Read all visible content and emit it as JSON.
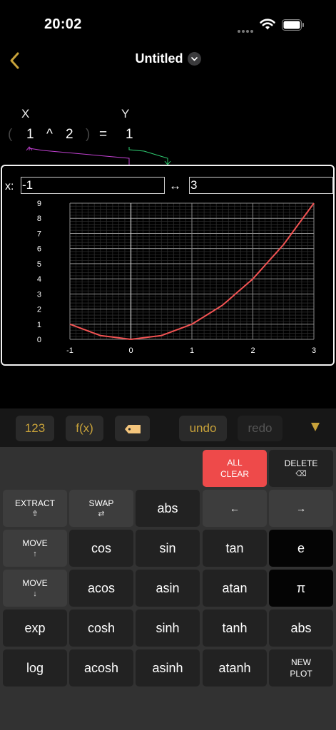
{
  "status": {
    "time": "20:02"
  },
  "nav": {
    "title": "Untitled"
  },
  "expression": {
    "label_x": "X",
    "label_y": "Y",
    "open_paren": "(",
    "base": "1",
    "operator": "^",
    "exponent": "2",
    "close_paren": ")",
    "equals": "=",
    "result": "1"
  },
  "plot": {
    "x_label": "x:",
    "range_min": "-1",
    "range_sep": "↔",
    "range_max": "3"
  },
  "chart_data": {
    "type": "line",
    "xlim": [
      -1,
      3
    ],
    "ylim": [
      0,
      9
    ],
    "x_ticks": [
      "-1",
      "0",
      "1",
      "2",
      "3"
    ],
    "y_ticks": [
      "0",
      "1",
      "2",
      "3",
      "4",
      "5",
      "6",
      "7",
      "8",
      "9"
    ],
    "grid": true,
    "series": [
      {
        "x": [
          -1,
          -0.5,
          0,
          0.5,
          1,
          1.5,
          2,
          2.5,
          3
        ],
        "y": [
          1,
          0.25,
          0,
          0.25,
          1,
          2.25,
          4,
          6.25,
          9
        ],
        "color": "#f25252"
      }
    ]
  },
  "toolbar": {
    "numbers": "123",
    "functions": "f(x)",
    "undo": "undo",
    "redo": "redo",
    "accent": "#c8a23a"
  },
  "keys": {
    "all_clear_1": "ALL",
    "all_clear_2": "CLEAR",
    "delete": "DELETE",
    "delete_icon": "⌫",
    "extract": "EXTRACT",
    "extract_icon": "⇮",
    "swap": "SWAP",
    "swap_icon": "⇄",
    "abs": "abs",
    "left": "←",
    "right": "→",
    "move_up": "MOVE",
    "up_icon": "↑",
    "cos": "cos",
    "sin": "sin",
    "tan": "tan",
    "e": "e",
    "move_down": "MOVE",
    "down_icon": "↓",
    "acos": "acos",
    "asin": "asin",
    "atan": "atan",
    "pi": "π",
    "exp": "exp",
    "cosh": "cosh",
    "sinh": "sinh",
    "tanh": "tanh",
    "abs2": "abs",
    "log": "log",
    "acosh": "acosh",
    "asinh": "asinh",
    "atanh": "atanh",
    "new_plot_1": "NEW",
    "new_plot_2": "PLOT"
  }
}
